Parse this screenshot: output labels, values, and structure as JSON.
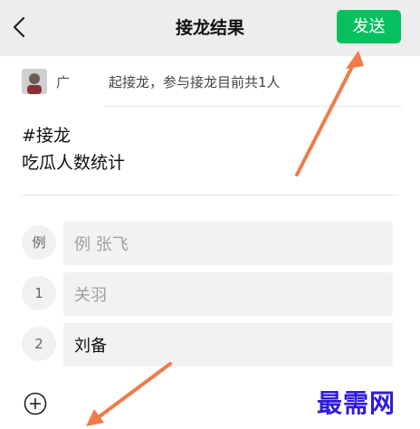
{
  "header": {
    "title": "接龙结果",
    "send_label": "发送"
  },
  "info": {
    "name": "广",
    "text": "起接龙，参与接龙目前共1人"
  },
  "content": {
    "line1": "#接龙",
    "line2": "吃瓜人数统计"
  },
  "entries": [
    {
      "index": "例",
      "text": "例 张飞",
      "filled": false
    },
    {
      "index": "1",
      "text": "关羽",
      "filled": false
    },
    {
      "index": "2",
      "text": "刘备",
      "filled": true
    }
  ],
  "watermark": {
    "text": "最需网"
  },
  "colors": {
    "send_button": "#07c160",
    "arrow": "#f07b4a"
  },
  "icons": [
    "back-arrow-icon",
    "add-circle-icon"
  ]
}
